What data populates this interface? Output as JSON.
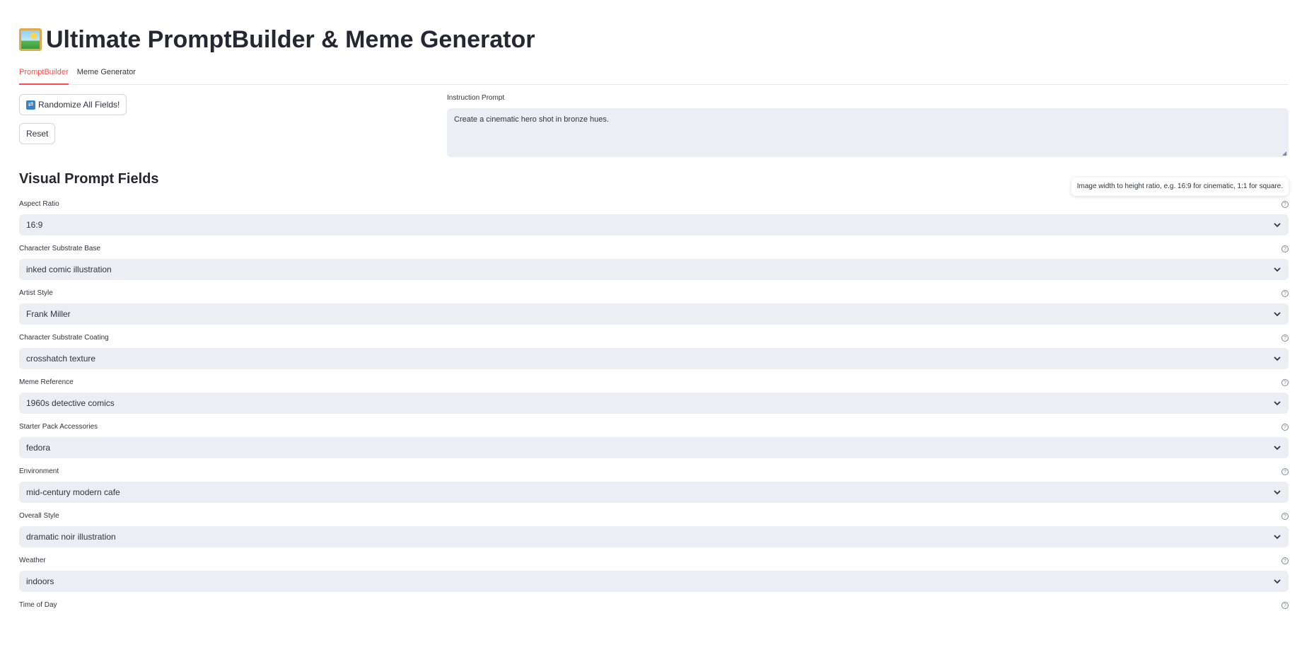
{
  "app": {
    "title": "Ultimate PromptBuilder & Meme Generator",
    "title_icon": "framed-picture-icon"
  },
  "tabs": [
    {
      "label": "PromptBuilder",
      "active": true
    },
    {
      "label": "Meme Generator",
      "active": false
    }
  ],
  "buttons": {
    "randomize_label": "Randomize All Fields!",
    "randomize_icon": "shuffle-icon",
    "reset_label": "Reset"
  },
  "instruction": {
    "label": "Instruction Prompt",
    "value": "Create a cinematic hero shot in bronze hues."
  },
  "section": {
    "title": "Visual Prompt Fields"
  },
  "tooltip": {
    "text": "Image width to height ratio, e.g. 16:9 for cinematic, 1:1 for square."
  },
  "fields": [
    {
      "label": "Aspect Ratio",
      "value": "16:9"
    },
    {
      "label": "Character Substrate Base",
      "value": "inked comic illustration"
    },
    {
      "label": "Artist Style",
      "value": "Frank Miller"
    },
    {
      "label": "Character Substrate Coating",
      "value": "crosshatch texture"
    },
    {
      "label": "Meme Reference",
      "value": "1960s detective comics"
    },
    {
      "label": "Starter Pack Accessories",
      "value": "fedora"
    },
    {
      "label": "Environment",
      "value": "mid-century modern cafe"
    },
    {
      "label": "Overall Style",
      "value": "dramatic noir illustration"
    },
    {
      "label": "Weather",
      "value": "indoors"
    },
    {
      "label": "Time of Day",
      "value": ""
    }
  ],
  "colors": {
    "accent": "#ff4b4b",
    "input_bg": "#eceef3",
    "text": "#31333f"
  }
}
